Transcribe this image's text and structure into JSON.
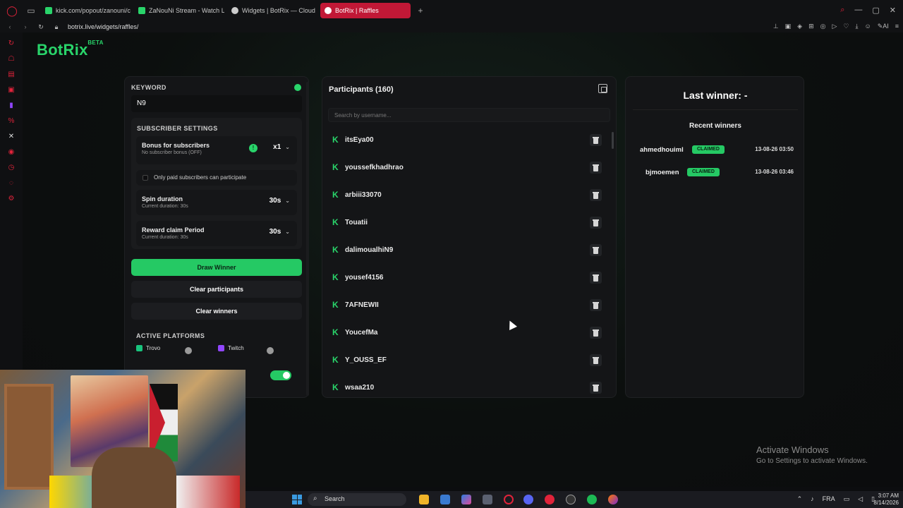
{
  "browser": {
    "tabs": [
      {
        "label": "kick.com/popout/zanouni/c",
        "favicon_color": "#29d46a",
        "active": false
      },
      {
        "label": "ZaNouNi Stream - Watch L",
        "favicon_color": "#29d46a",
        "active": false
      },
      {
        "label": "Widgets | BotRix — Cloud",
        "favicon_color": "#cccccc",
        "active": false
      },
      {
        "label": "BotRix | Raffles",
        "favicon_color": "#ffffff",
        "active": true
      }
    ],
    "url": "botrix.live/widgets/raffles/"
  },
  "brand": {
    "name": "BotRix",
    "badge": "BETA",
    "accent": "#29d46a"
  },
  "settings": {
    "keyword_label": "KEYWORD",
    "keyword_value": "N9",
    "subscriber_title": "SUBSCRIBER SETTINGS",
    "bonus": {
      "title": "Bonus for subscribers",
      "subtitle": "No subscriber bonus (OFF)",
      "value": "x1"
    },
    "only_paid": "Only paid subscribers can participate",
    "spin": {
      "title": "Spin duration",
      "subtitle": "Current duration: 30s",
      "value": "30s"
    },
    "claim": {
      "title": "Reward claim Period",
      "subtitle": "Current duration: 30s",
      "value": "30s"
    },
    "draw_winner": "Draw Winner",
    "clear_participants": "Clear participants",
    "clear_winners": "Clear winners",
    "platforms_title": "ACTIVE PLATFORMS",
    "platforms": [
      {
        "name": "Trovo",
        "color": "#19c37d"
      },
      {
        "name": "Twitch",
        "color": "#9146ff"
      }
    ]
  },
  "participants": {
    "title": "Participants (160)",
    "search_placeholder": "Search by username...",
    "items": [
      "itsEya00",
      "youssefkhadhrao",
      "arbiii33070",
      "Touatii",
      "dalimoualhiN9",
      "yousef4156",
      "7AFNEWII",
      "YoucefMa",
      "Y_OUSS_EF",
      "wsaa210"
    ]
  },
  "winners": {
    "last_winner": "Last winner: -",
    "recent_title": "Recent winners",
    "items": [
      {
        "name": "ahmedhouiml",
        "status": "CLAIMED",
        "date": "13-08-26 03:50"
      },
      {
        "name": "bjmoemen",
        "status": "CLAIMED",
        "date": "13-08-26 03:46"
      }
    ]
  },
  "taskbar": {
    "search": "Search",
    "lang": "FRA",
    "time": "3:07 AM",
    "date": "8/14/2026"
  },
  "watermark": {
    "line1": "Activate Windows",
    "line2": "Go to Settings to activate Windows."
  }
}
